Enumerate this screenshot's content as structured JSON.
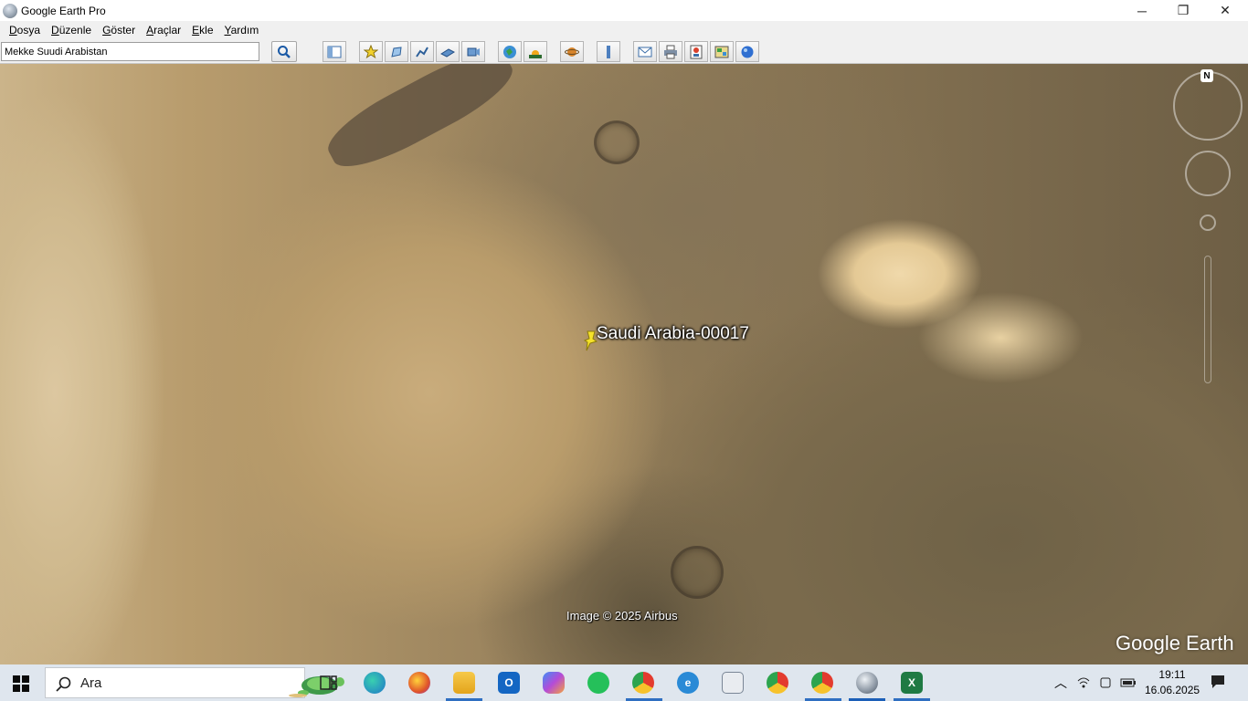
{
  "window": {
    "title": "Google Earth Pro",
    "minimize_glyph": "─",
    "maximize_glyph": "❐",
    "close_glyph": "✕"
  },
  "menu": {
    "items": [
      {
        "label": "Dosya",
        "accel": "D",
        "rest": "osya"
      },
      {
        "label": "Düzenle",
        "accel": "D",
        "rest": "üzenle"
      },
      {
        "label": "Göster",
        "accel": "G",
        "rest": "öster"
      },
      {
        "label": "Araçlar",
        "accel": "A",
        "rest": "raçlar"
      },
      {
        "label": "Ekle",
        "accel": "E",
        "rest": "kle"
      },
      {
        "label": "Yardım",
        "accel": "Y",
        "rest": "ardım"
      }
    ]
  },
  "toolbar": {
    "search_value": "Mekke Suudi Arabistan",
    "buttons": [
      "sidebar-toggle-icon",
      "add-placemark-icon",
      "add-polygon-icon",
      "add-path-icon",
      "add-image-overlay-icon",
      "record-tour-icon",
      "historical-imagery-icon",
      "sunlight-icon",
      "planets-icon",
      "ruler-icon",
      "email-icon",
      "print-icon",
      "save-image-icon",
      "view-in-maps-icon",
      "google-maps-icon"
    ]
  },
  "map": {
    "placemark_label": "Saudi Arabia-00017",
    "attribution": "Image © 2025 Airbus",
    "brand": "Google Earth",
    "compass_north": "N"
  },
  "taskbar": {
    "search_placeholder": "Ara",
    "time": "19:11",
    "date": "16.06.2025",
    "accent": "#2f6fc1"
  }
}
